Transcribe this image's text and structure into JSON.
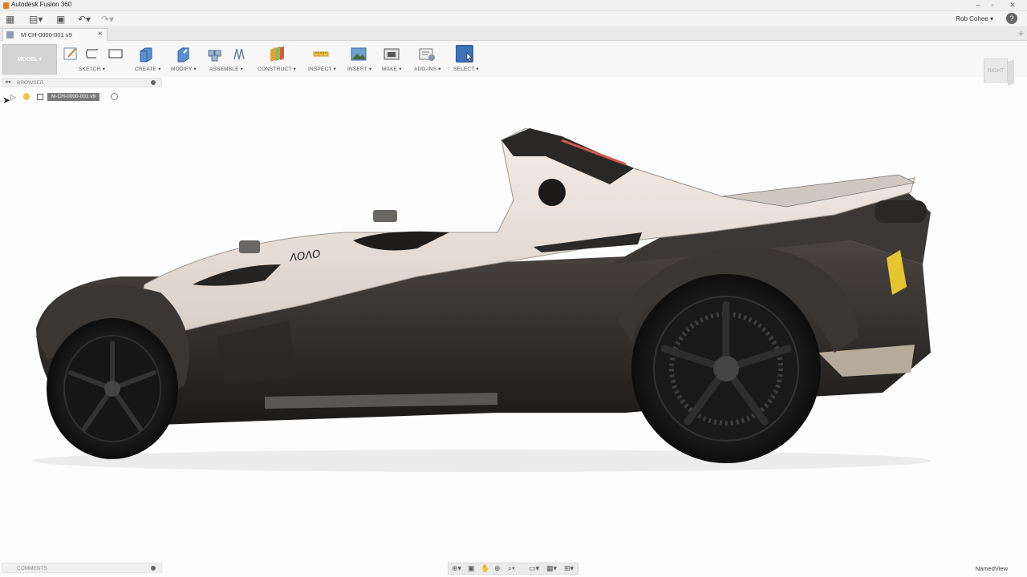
{
  "window": {
    "title": "Autodesk Fusion 360"
  },
  "quick_access": {
    "user_name": "Rob Cohee ▾",
    "help_label": "?"
  },
  "document_tab": {
    "label": "M-CH-0000-001 v9",
    "close": "×",
    "add": "+"
  },
  "toolbar": {
    "workspace": "MODEL ▾",
    "groups": [
      {
        "id": "sketch",
        "label": "SKETCH ▾"
      },
      {
        "id": "create",
        "label": "CREATE ▾"
      },
      {
        "id": "modify",
        "label": "MODIFY ▾"
      },
      {
        "id": "assemble",
        "label": "ASSEMBLE ▾"
      },
      {
        "id": "construct",
        "label": "CONSTRUCT ▾"
      },
      {
        "id": "inspect",
        "label": "INSPECT ▾"
      },
      {
        "id": "insert",
        "label": "INSERT ▾"
      },
      {
        "id": "make",
        "label": "MAKE ▾"
      },
      {
        "id": "addins",
        "label": "ADD-INS ▾"
      },
      {
        "id": "select",
        "label": "SELECT ▾"
      }
    ]
  },
  "browser": {
    "title": "BROWSER",
    "root_component": "M-CH-0000-001 v9"
  },
  "viewcube": {
    "face": "RIGHT"
  },
  "model": {
    "badge_text": "ΛΟΛΟ"
  },
  "comments": {
    "title": "COMMENTS"
  },
  "named_view": "NamedView",
  "colors": {
    "select_accent": "#3c72b8",
    "app_icon": "#e07b1e"
  }
}
